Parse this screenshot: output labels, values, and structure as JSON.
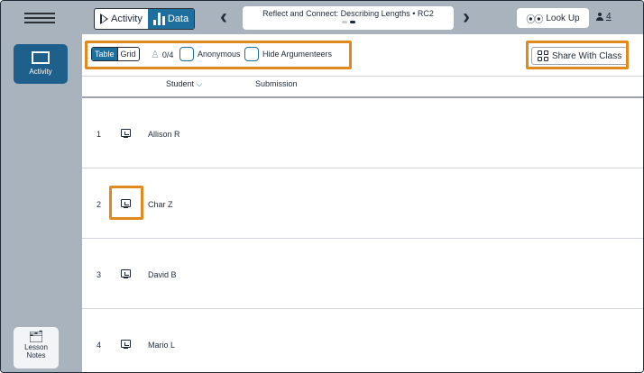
{
  "topbar": {
    "activity_label": "Activity",
    "data_label": "Data",
    "title": "Reflect and Connect: Describing Lengths • RC2",
    "lookup_label": "Look Up",
    "user_count": "4"
  },
  "sidebar": {
    "activity_label": "Activity",
    "lesson_notes_line1": "Lesson",
    "lesson_notes_line2": "Notes"
  },
  "toolbar": {
    "table_label": "Table",
    "grid_label": "Grid",
    "submitted_count": "0/4",
    "anonymous_label": "Anonymous",
    "hide_argumenteers_label": "Hide Argumenteers",
    "share_label": "Share With Class"
  },
  "table": {
    "headers": {
      "student": "Student",
      "submission": "Submission"
    },
    "rows": [
      {
        "num": "1",
        "name": "Allison R"
      },
      {
        "num": "2",
        "name": "Char Z"
      },
      {
        "num": "3",
        "name": "David B"
      },
      {
        "num": "4",
        "name": "Mario L"
      }
    ]
  },
  "colors": {
    "accent": "#1f6f9e",
    "highlight": "#e08a1e",
    "chrome": "#a9b3bd"
  }
}
